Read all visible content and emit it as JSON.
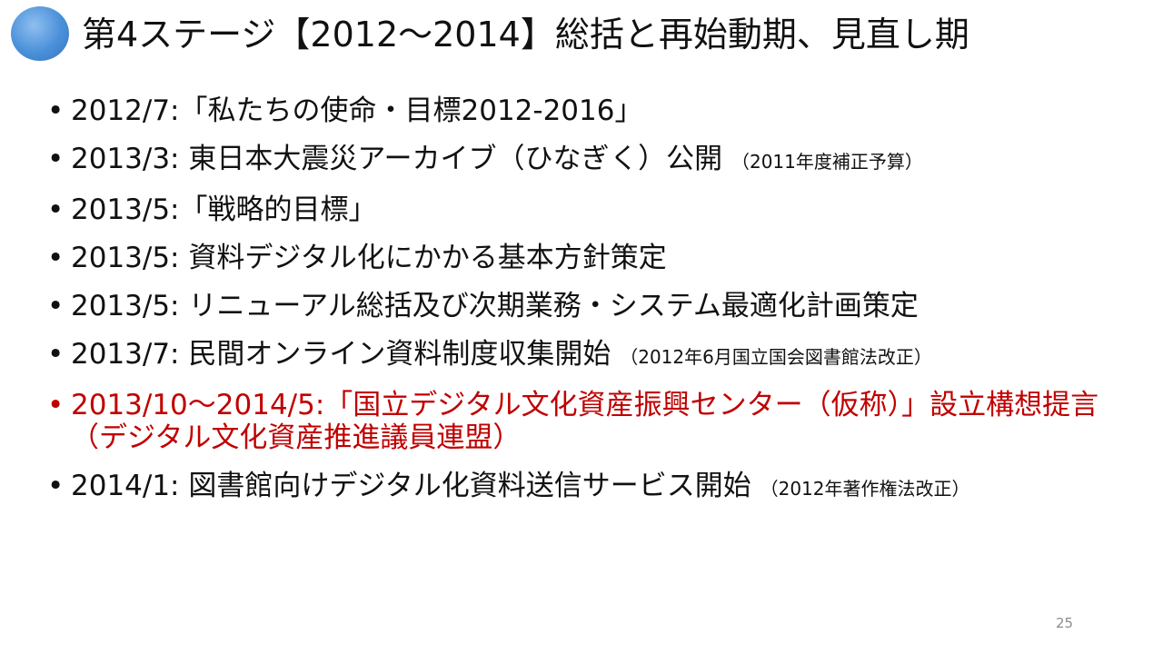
{
  "slide": {
    "title": "第4ステージ【2012～2014】総括と再始動期、見直し期",
    "page_number": "25",
    "bullet_symbol": "•",
    "colors": {
      "text": "#111111",
      "highlight": "#c00000",
      "accent_circle": "#4a90d9",
      "page_number": "#8c8c8c"
    },
    "items": [
      {
        "main": "2012/7:「私たちの使命・目標2012-2016」",
        "note": ""
      },
      {
        "main": "2013/3: 東日本大震災アーカイブ（ひなぎく）公開",
        "note": "（2011年度補正予算）"
      },
      {
        "main": "2013/5:「戦略的目標」",
        "note": ""
      },
      {
        "main": "2013/5: 資料デジタル化にかかる基本方針策定",
        "note": ""
      },
      {
        "main": "2013/5: リニューアル総括及び次期業務・システム最適化計画策定",
        "note": ""
      },
      {
        "main": "2013/7: 民間オンライン資料制度収集開始",
        "note": "（2012年6月国立国会図書館法改正）"
      },
      {
        "main": "2013/10～2014/5:「国立デジタル文化資産振興センター（仮称）」設立構想提言（デジタル文化資産推進議員連盟）",
        "note": ""
      },
      {
        "main": "2014/1: 図書館向けデジタル化資料送信サービス開始",
        "note": "（2012年著作権法改正）"
      }
    ]
  }
}
